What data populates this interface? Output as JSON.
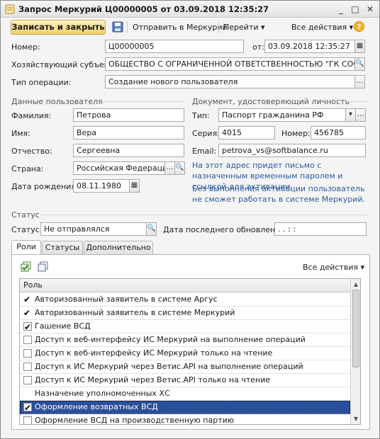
{
  "window": {
    "title": "Запрос Меркурий Ц00000005 от 03.09.2018 12:35:27",
    "min": "_",
    "max": "□",
    "close": "✕"
  },
  "toolbar": {
    "save_close": "Записать и закрыть",
    "send": "Отправить в Меркурий",
    "goto": "Перейти ▾",
    "all_actions": "Все действия ▾",
    "help": "?"
  },
  "header": {
    "number_label": "Номер:",
    "number_value": "Ц00000005",
    "date_label": "от:",
    "date_value": "03.09.2018 12:35:27",
    "subject_label": "Хозяйствующий субъект:",
    "subject_value": "ОБЩЕСТВО С ОГРАНИЧЕННОЙ ОТВЕТСТВЕННОСТЬЮ \"ГК СОФТБАЛАНС\"",
    "optype_label": "Тип операции:",
    "optype_value": "Создание нового пользователя"
  },
  "user": {
    "section": "Данные пользователя",
    "lastname_label": "Фамилия:",
    "lastname_value": "Петрова",
    "firstname_label": "Имя:",
    "firstname_value": "Вера",
    "middlename_label": "Отчество:",
    "middlename_value": "Сергеевна",
    "country_label": "Страна:",
    "country_value": "Российская Федерация",
    "birth_label": "Дата рождения:",
    "birth_value": "08.11.1980"
  },
  "document": {
    "section": "Документ, удостоверяющий личность",
    "type_label": "Тип:",
    "type_value": "Паспорт гражданина РФ",
    "series_label": "Серия:",
    "series_value": "4015",
    "number_label": "Номер:",
    "number_value": "456785",
    "email_label": "Email:",
    "email_value": "petrova_vs@softbalance.ru",
    "note1": "На этот адрес придет письмо с назначенным временным паролем и ссылкой для активации.",
    "note2": "Без выполнения активации пользователь не сможет работать в системе Меркурий."
  },
  "status": {
    "section": "Статус",
    "status_label": "Статус:",
    "status_value": "Не отправлялся",
    "updated_label": "Дата последнего обновления:",
    "updated_value": " .  .       :  :"
  },
  "tabs": [
    "Роли",
    "Статусы",
    "Дополнительно"
  ],
  "roles": {
    "all_actions": "Все действия ▾",
    "column": "Роль",
    "rows": [
      {
        "label": "Авторизованный заявитель в системе Аргус",
        "checked": true,
        "box": false
      },
      {
        "label": "Авторизованный заявитель в системе Меркурий",
        "checked": true,
        "box": false
      },
      {
        "label": "Гашение ВСД",
        "checked": true,
        "box": true
      },
      {
        "label": "Доступ к веб-интерфейсу ИС Меркурий на выполнение операций",
        "checked": false,
        "box": true
      },
      {
        "label": "Доступ к веб-интерфейсу ИС Меркурий только на чтение",
        "checked": false,
        "box": true
      },
      {
        "label": "Доступ к ИС Меркурий через Ветис.API на выполнение операций",
        "checked": false,
        "box": true
      },
      {
        "label": "Доступ к ИС Меркурий через Ветис.API только на чтение",
        "checked": false,
        "box": true
      },
      {
        "label": "Назначение уполномоченных ХС",
        "checked": false,
        "box": false
      },
      {
        "label": "Оформление возвратных ВСД",
        "checked": true,
        "box": true,
        "selected": true
      },
      {
        "label": "Оформление ВСД на производственную партию",
        "checked": false,
        "box": true
      }
    ],
    "check_mark": "✔"
  }
}
